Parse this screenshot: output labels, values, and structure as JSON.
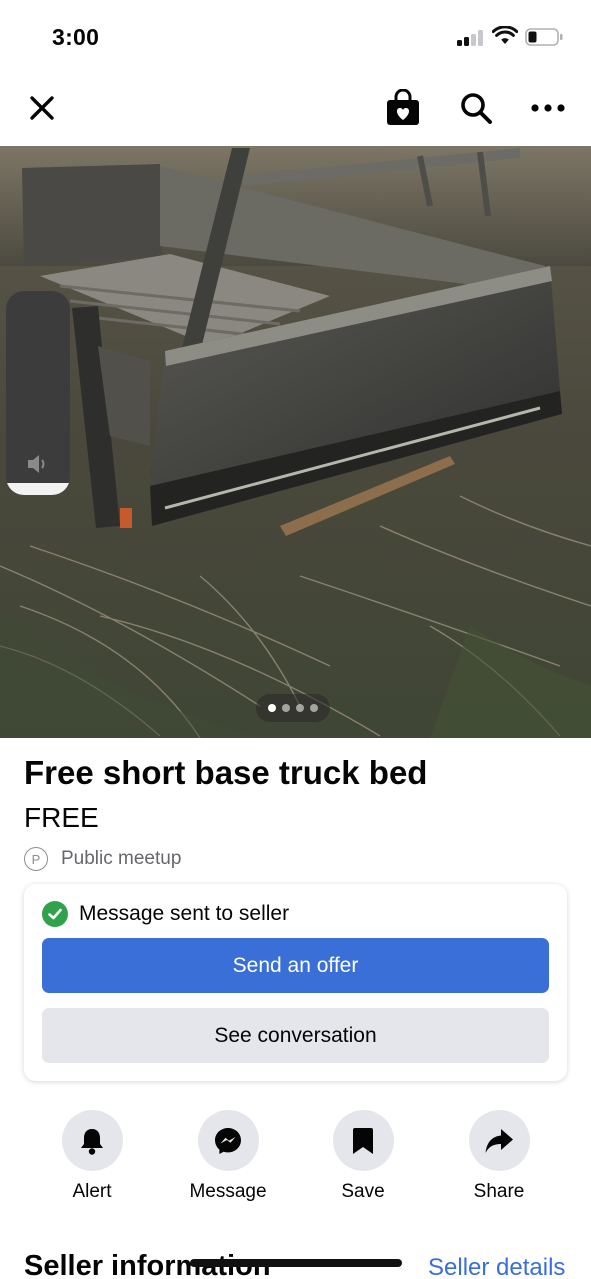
{
  "status_bar": {
    "time": "3:00",
    "icons": [
      "cellular-signal-icon",
      "wifi-icon",
      "battery-icon"
    ]
  },
  "nav": {
    "icons": [
      "close-icon",
      "shopping-bag-icon",
      "search-icon",
      "more-icon"
    ]
  },
  "photo": {
    "page_count": 4,
    "active_page": 1
  },
  "listing": {
    "title": "Free short base truck bed",
    "price": "FREE",
    "meetup_icon": "P",
    "meetup": "Public meetup"
  },
  "message_card": {
    "status": "Message sent to seller",
    "primary_button": "Send an offer",
    "secondary_button": "See conversation"
  },
  "actions": [
    {
      "label": "Alert",
      "icon": "bell-icon"
    },
    {
      "label": "Message",
      "icon": "messenger-icon"
    },
    {
      "label": "Save",
      "icon": "bookmark-icon"
    },
    {
      "label": "Share",
      "icon": "share-icon"
    }
  ],
  "seller": {
    "title": "Seller information",
    "link": "Seller details"
  },
  "colors": {
    "accent": "#3a6fd8",
    "success": "#31a24c",
    "secondary_button": "#e4e6eb",
    "text": "#050505",
    "muted": "#65676b"
  }
}
